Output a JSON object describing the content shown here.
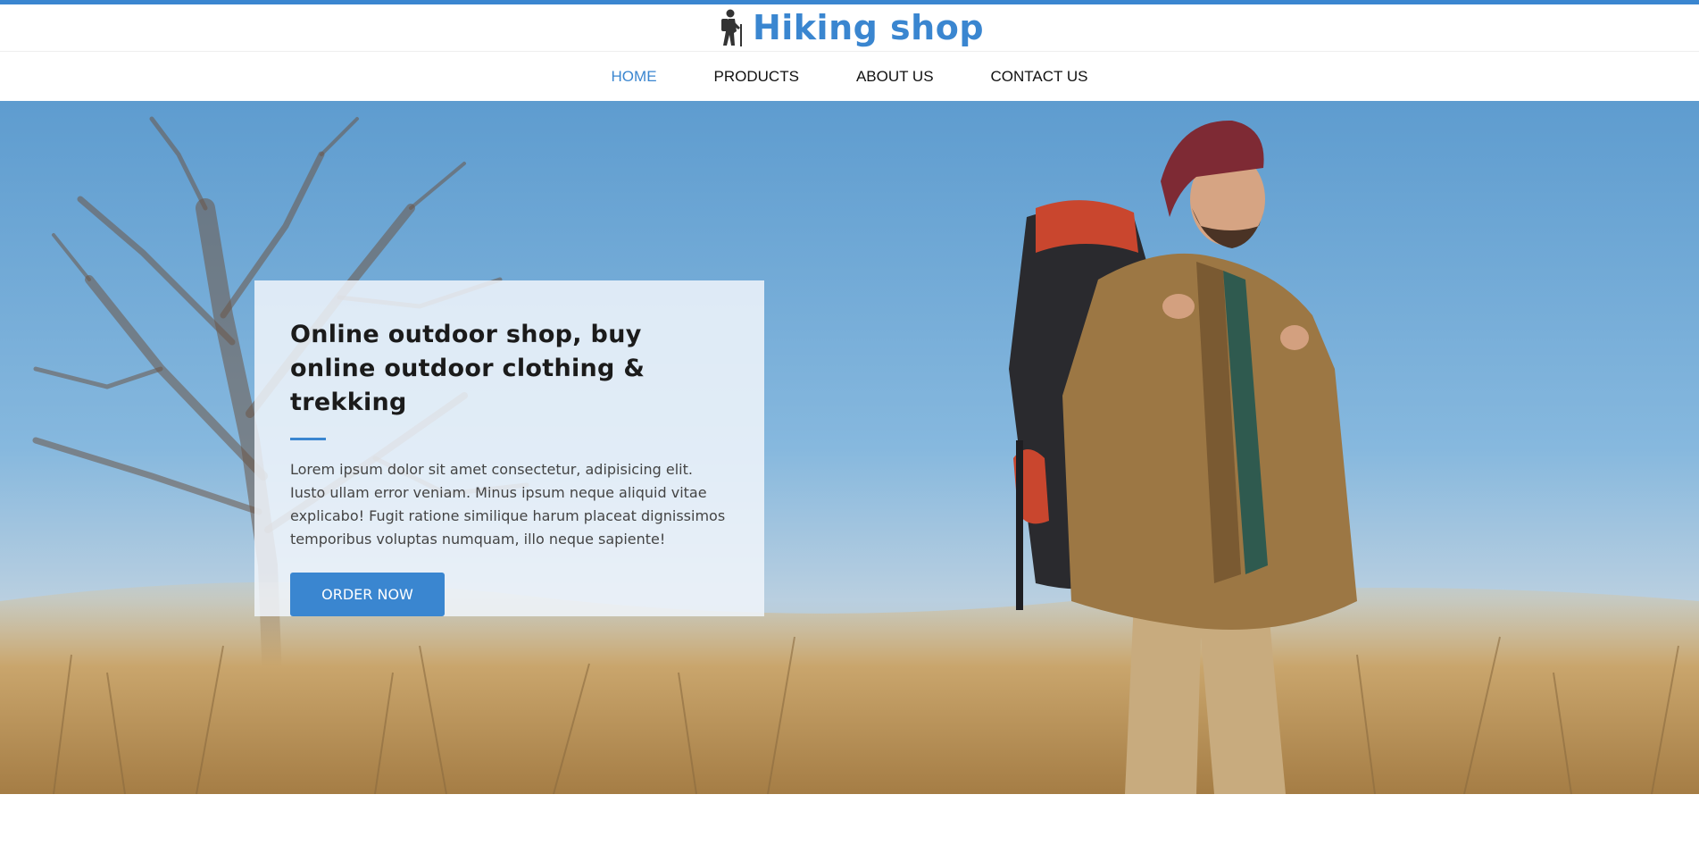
{
  "brand": {
    "name": "Hiking shop",
    "icon": "hiker-icon",
    "color": "#3a86d0"
  },
  "nav": {
    "items": [
      {
        "label": "HOME",
        "active": true
      },
      {
        "label": "PRODUCTS",
        "active": false
      },
      {
        "label": "ABOUT US",
        "active": false
      },
      {
        "label": "CONTACT US",
        "active": false
      }
    ]
  },
  "hero": {
    "title": "Online outdoor shop, buy online outdoor clothing & trekking",
    "text": "Lorem ipsum dolor sit amet consectetur, adipisicing elit. Iusto ullam error veniam. Minus ipsum neque aliquid vitae explicabo! Fugit ratione similique harum placeat dignissimos temporibus voluptas numquam, illo neque sapiente!",
    "button_label": "ORDER NOW"
  }
}
